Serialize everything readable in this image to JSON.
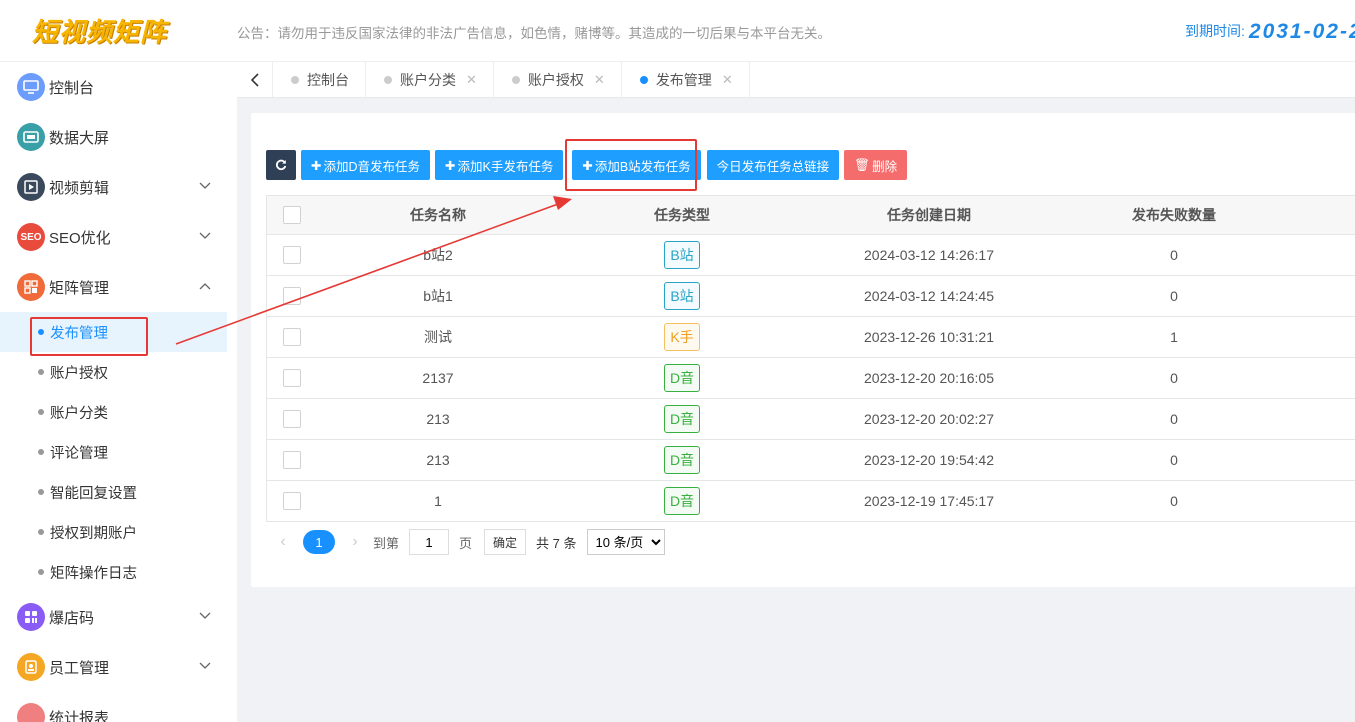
{
  "header": {
    "logo": "短视频矩阵",
    "notice": "公告：请勿用于违反国家法律的非法广告信息，如色情，赌博等。其造成的一切后果与本平台无关。",
    "expire_label": "到期时间:",
    "expire_date": "2031-02-2"
  },
  "sidebar": {
    "items": [
      {
        "label": "控制台",
        "icon": "monitor-icon",
        "color": "#6c9dfc"
      },
      {
        "label": "数据大屏",
        "icon": "screen-icon",
        "color": "#3aa0a8"
      },
      {
        "label": "视频剪辑",
        "icon": "video-edit-icon",
        "color": "#3a4a5c"
      },
      {
        "label": "SEO优化",
        "icon": "seo-icon",
        "color": "#e84a3c",
        "icon_text": "SEO"
      },
      {
        "label": "矩阵管理",
        "icon": "matrix-icon",
        "color": "#f06a3a"
      }
    ],
    "sub_items": [
      "发布管理",
      "账户授权",
      "账户分类",
      "评论管理",
      "智能回复设置",
      "授权到期账户",
      "矩阵操作日志"
    ],
    "bottom_items": [
      {
        "label": "爆店码",
        "icon": "qr-grid-icon",
        "color": "#8a5cf6"
      },
      {
        "label": "员工管理",
        "icon": "staff-icon",
        "color": "#f5a623"
      },
      {
        "label": "统计报表",
        "icon": "report-icon",
        "color": "#f08080"
      }
    ]
  },
  "tabs": [
    {
      "label": "控制台",
      "closable": false
    },
    {
      "label": "账户分类",
      "closable": true
    },
    {
      "label": "账户授权",
      "closable": true
    },
    {
      "label": "发布管理",
      "closable": true,
      "active": true
    }
  ],
  "toolbar": {
    "add_d": "添加D音发布任务",
    "add_k": "添加K手发布任务",
    "add_b": "添加B站发布任务",
    "today_link": "今日发布任务总链接",
    "delete": "删除"
  },
  "table": {
    "headers": [
      "任务名称",
      "任务类型",
      "任务创建日期",
      "发布失败数量"
    ],
    "rows": [
      {
        "name": "b站2",
        "type": "B站",
        "kind": "b",
        "date": "2024-03-12 14:26:17",
        "fail": "0"
      },
      {
        "name": "b站1",
        "type": "B站",
        "kind": "b",
        "date": "2024-03-12 14:24:45",
        "fail": "0"
      },
      {
        "name": "测试",
        "type": "K手",
        "kind": "k",
        "date": "2023-12-26 10:31:21",
        "fail": "1"
      },
      {
        "name": "2137",
        "type": "D音",
        "kind": "d",
        "date": "2023-12-20 20:16:05",
        "fail": "0"
      },
      {
        "name": "213",
        "type": "D音",
        "kind": "d",
        "date": "2023-12-20 20:02:27",
        "fail": "0"
      },
      {
        "name": "213",
        "type": "D音",
        "kind": "d",
        "date": "2023-12-20 19:54:42",
        "fail": "0"
      },
      {
        "name": "1",
        "type": "D音",
        "kind": "d",
        "date": "2023-12-19 17:45:17",
        "fail": "0"
      }
    ]
  },
  "pager": {
    "current": "1",
    "goto_label": "到第",
    "goto_value": "1",
    "page_label": "页",
    "confirm": "确定",
    "total": "共 7 条",
    "page_size": "10 条/页"
  }
}
